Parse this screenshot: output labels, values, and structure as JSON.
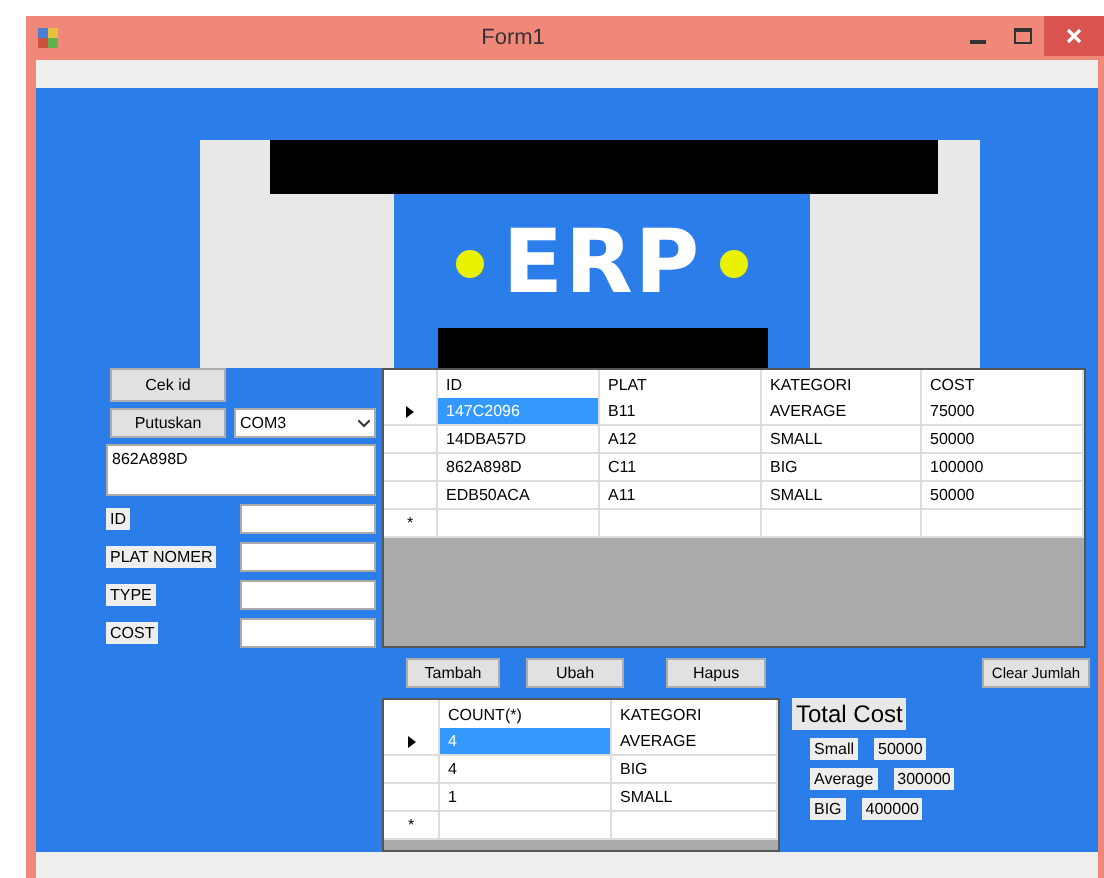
{
  "window": {
    "title": "Form1"
  },
  "logo": {
    "text": "ERP"
  },
  "connection": {
    "check_button": "Cek id",
    "disconnect_button": "Putuskan",
    "port": "COM3",
    "received_id": "862A898D"
  },
  "fields": [
    {
      "label": "ID"
    },
    {
      "label": "PLAT NOMER"
    },
    {
      "label": "TYPE"
    },
    {
      "label": "COST"
    }
  ],
  "vehicles_table": {
    "columns": [
      "ID",
      "PLAT",
      "KATEGORI",
      "COST"
    ],
    "new_row_marker": "*",
    "rows": [
      {
        "selected": true,
        "cells": [
          "147C2096",
          "B11",
          "AVERAGE",
          "75000"
        ]
      },
      {
        "selected": false,
        "cells": [
          "14DBA57D",
          "A12",
          "SMALL",
          "50000"
        ]
      },
      {
        "selected": false,
        "cells": [
          "862A898D",
          "C11",
          "BIG",
          "100000"
        ]
      },
      {
        "selected": false,
        "cells": [
          "EDB50ACA",
          "A11",
          "SMALL",
          "50000"
        ]
      }
    ]
  },
  "actions": [
    "Tambah",
    "Ubah",
    "Hapus"
  ],
  "clear_button": "Clear Jumlah",
  "count_table": {
    "columns": [
      "COUNT(*)",
      "KATEGORI"
    ],
    "new_row_marker": "*",
    "rows": [
      {
        "selected": true,
        "cells": [
          "4",
          "AVERAGE"
        ]
      },
      {
        "selected": false,
        "cells": [
          "4",
          "BIG"
        ]
      },
      {
        "selected": false,
        "cells": [
          "1",
          "SMALL"
        ]
      }
    ]
  },
  "total_cost": {
    "title": "Total Cost",
    "items": [
      {
        "label": "Small",
        "value": "50000"
      },
      {
        "label": "Average",
        "value": "300000"
      },
      {
        "label": "BIG",
        "value": "400000"
      }
    ]
  }
}
